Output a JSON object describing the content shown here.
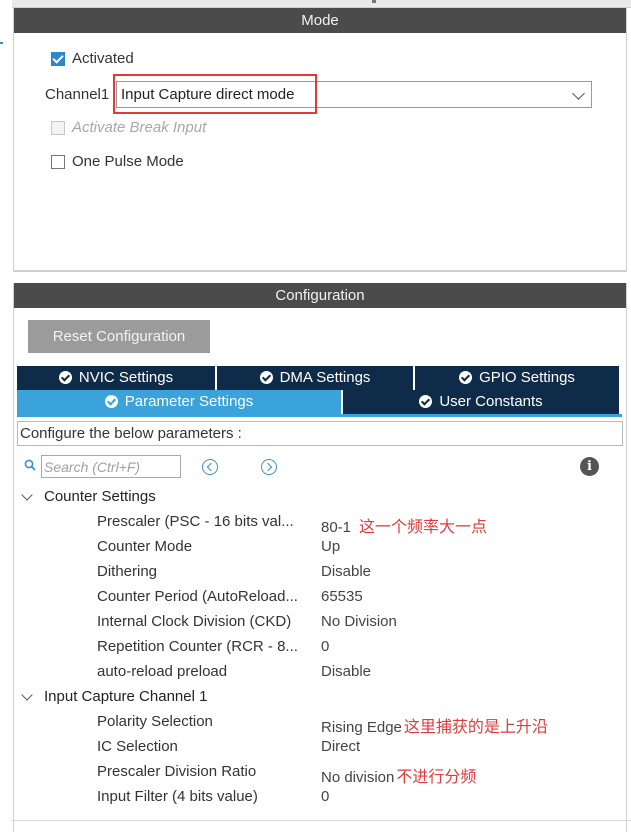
{
  "mode": {
    "header": "Mode",
    "activated_label": "Activated",
    "activated_checked": true,
    "channel_label": "Channel1",
    "channel_value": "Input Capture direct mode",
    "break_input_label": "Activate Break Input",
    "one_pulse_label": "One Pulse Mode"
  },
  "configuration": {
    "header": "Configuration",
    "reset_label": "Reset Configuration",
    "tabs": [
      {
        "label": "NVIC Settings",
        "active": false
      },
      {
        "label": "DMA Settings",
        "active": false
      },
      {
        "label": "GPIO Settings",
        "active": false
      },
      {
        "label": "Parameter Settings",
        "active": true
      },
      {
        "label": "User Constants",
        "active": false
      }
    ],
    "description": "Configure the below parameters :",
    "search_placeholder": "Search (Ctrl+F)",
    "groups": [
      {
        "name": "Counter Settings",
        "params": [
          {
            "name": "Prescaler (PSC - 16 bits val...",
            "value": "80-1",
            "note": "这一个频率大一点"
          },
          {
            "name": "Counter Mode",
            "value": "Up"
          },
          {
            "name": "Dithering",
            "value": "Disable"
          },
          {
            "name": "Counter Period (AutoReload...",
            "value": "65535"
          },
          {
            "name": "Internal Clock Division (CKD)",
            "value": "No Division"
          },
          {
            "name": "Repetition Counter (RCR - 8...",
            "value": "0"
          },
          {
            "name": "auto-reload preload",
            "value": "Disable"
          }
        ]
      },
      {
        "name": "Input Capture Channel 1",
        "params": [
          {
            "name": "Polarity Selection",
            "value": "Rising Edge",
            "note": "这里捕获的是上升沿"
          },
          {
            "name": "IC Selection",
            "value": "Direct"
          },
          {
            "name": "Prescaler Division Ratio",
            "value": "No division",
            "note": "不进行分频"
          },
          {
            "name": "Input Filter (4 bits value)",
            "value": "0"
          }
        ]
      }
    ]
  },
  "colors": {
    "header_bg": "#4b4b4b",
    "tab_dark": "#0f2b4a",
    "tab_active": "#3aa3dc",
    "highlight_red": "#e03b3b",
    "checkbox_blue": "#2d87cf"
  }
}
